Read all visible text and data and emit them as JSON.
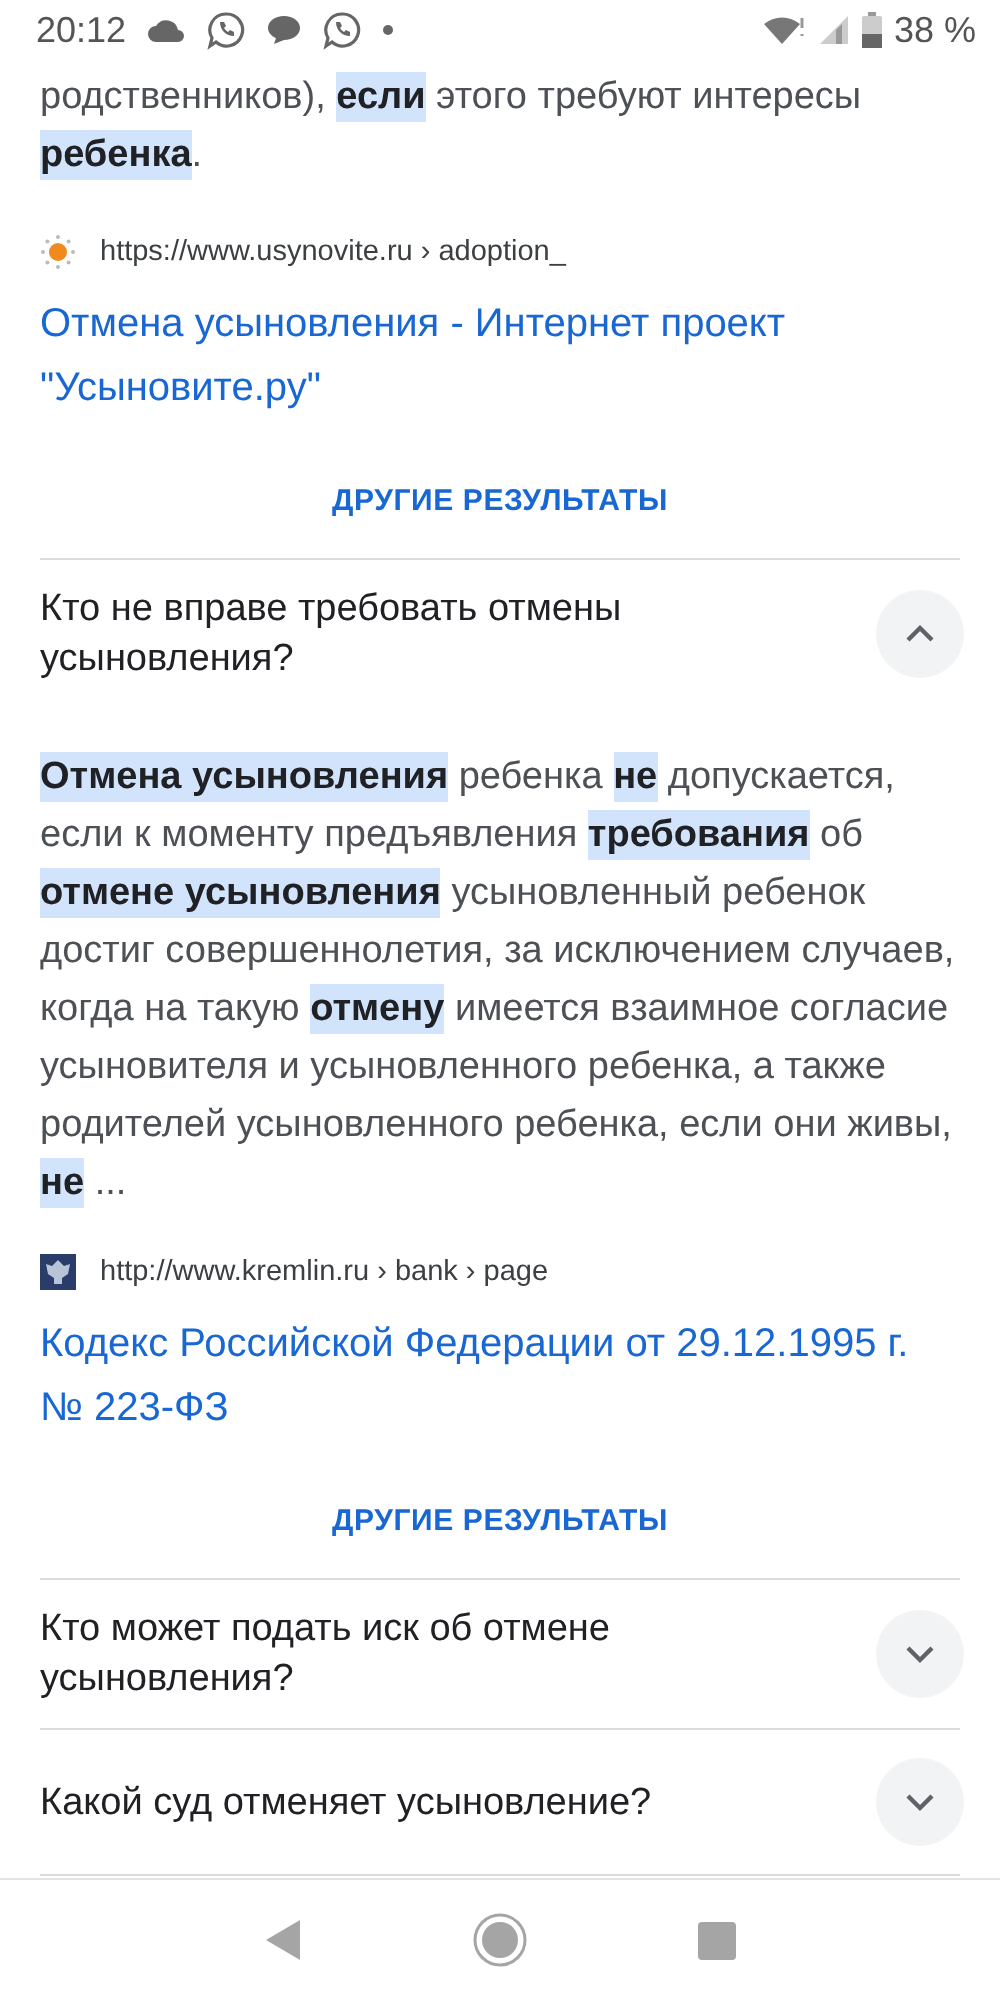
{
  "status_bar": {
    "time": "20:12",
    "battery_text": "38 %"
  },
  "blocks": [
    {
      "kind": "snippet",
      "text": "родственников), **если** этого требуют интересы **ребенка**."
    },
    {
      "kind": "source",
      "favicon": {
        "kind": "sun"
      },
      "url": "https://www.usynovite.ru › adoption_",
      "title": "Отмена усыновления - Интернет проект \"Усыновите.ру\""
    },
    {
      "kind": "more",
      "label": "ДРУГИЕ РЕЗУЛЬТАТЫ"
    },
    {
      "kind": "question",
      "text": "Кто не вправе требовать отмены усыновления?",
      "expanded": true
    },
    {
      "kind": "snippet",
      "text": "**Отмена усыновления** ребенка **не** допускается, если к моменту предъявления **требования** об **отмене усыновления** усыновленный ребенок достиг совершеннолетия, за исключением случаев, когда на такую **отмену** имеется взаимное согласие усыновителя и усыновленного ребенка, а также родителей усыновленного ребенка, если они живы, **не** ..."
    },
    {
      "kind": "source",
      "favicon": {
        "kind": "emblem"
      },
      "url": "http://www.kremlin.ru › bank › page",
      "title": "Кодекс Российской Федерации от 29.12.1995 г. № 223-ФЗ"
    },
    {
      "kind": "more",
      "label": "ДРУГИЕ РЕЗУЛЬТАТЫ"
    },
    {
      "kind": "question",
      "text": "Кто может подать иск об отмене усыновления?",
      "expanded": false
    },
    {
      "kind": "question",
      "text": "Какой суд отменяет усыновление?",
      "expanded": false
    }
  ]
}
